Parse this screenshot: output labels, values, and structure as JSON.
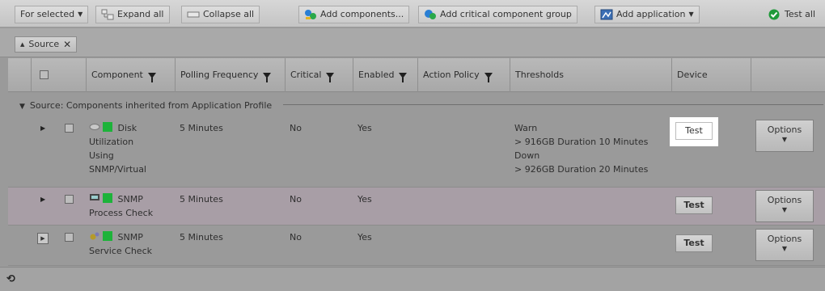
{
  "toolbar": {
    "for_selected": "For selected",
    "expand_all": "Expand all",
    "collapse_all": "Collapse all",
    "add_components": "Add components...",
    "add_critical_group": "Add critical component group",
    "add_application": "Add application",
    "test_all": "Test all"
  },
  "filter": {
    "chip_label": "Source",
    "chip_remove": "✕"
  },
  "columns": {
    "component": "Component",
    "polling": "Polling Frequency",
    "critical": "Critical",
    "enabled": "Enabled",
    "action_policy": "Action Policy",
    "thresholds": "Thresholds",
    "device": "Device"
  },
  "group": {
    "label": "Source: Components inherited from Application Profile"
  },
  "rows": [
    {
      "name_lines": [
        "Disk",
        "Utilization",
        "Using",
        "SNMP/Virtual"
      ],
      "polling": "5 Minutes",
      "critical": "No",
      "enabled": "Yes",
      "thresholds": [
        "Warn",
        "> 916GB Duration 10 Minutes",
        "Down",
        "> 926GB Duration 20 Minutes"
      ],
      "test": "Test",
      "options": "Options"
    },
    {
      "name_lines": [
        "SNMP",
        "Process Check"
      ],
      "polling": "5 Minutes",
      "critical": "No",
      "enabled": "Yes",
      "test": "Test",
      "options": "Options"
    },
    {
      "name_lines": [
        "SNMP",
        "Service Check"
      ],
      "polling": "5 Minutes",
      "critical": "No",
      "enabled": "Yes",
      "test": "Test",
      "options": "Options"
    }
  ],
  "colors": {
    "status_green": "#1db33a",
    "row_highlight": "#a89ea6"
  }
}
